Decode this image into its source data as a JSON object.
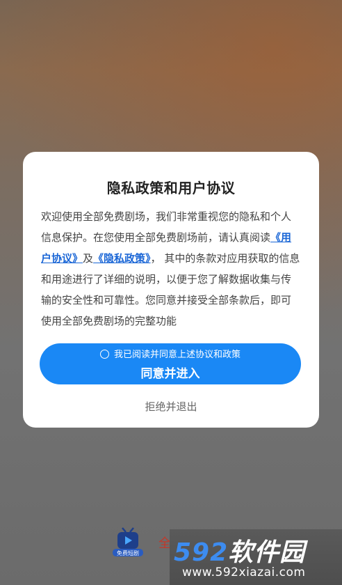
{
  "dialog": {
    "title": "隐私政策和用户协议",
    "text_part1": "欢迎使用全部免费剧场，我们非常重视您的隐私和个人信息保护。在您使用全部免费剧场前，请认真阅读",
    "user_agreement_link": "《用户协议》",
    "text_and": "及",
    "privacy_policy_link": "《隐私政策》",
    "text_part2": "， 其中的条款对应用获取的信息和用途进行了详细的说明，以便于您了解数据收集与传输的安全性和可靠性。您同意并接受全部条款后，即可使用全部免费剧场的完整功能",
    "checkbox_label": "我已阅读并同意上述协议和政策",
    "agree_button": "同意并进入",
    "reject_button": "拒绝并退出"
  },
  "background": {
    "app_logo_label": "免费短剧",
    "app_name": "全"
  },
  "watermark": {
    "number": "592",
    "text": "软件园",
    "url": "www.592xiazai.com"
  },
  "colors": {
    "accent": "#1a88f5",
    "link": "#1a66d6"
  }
}
